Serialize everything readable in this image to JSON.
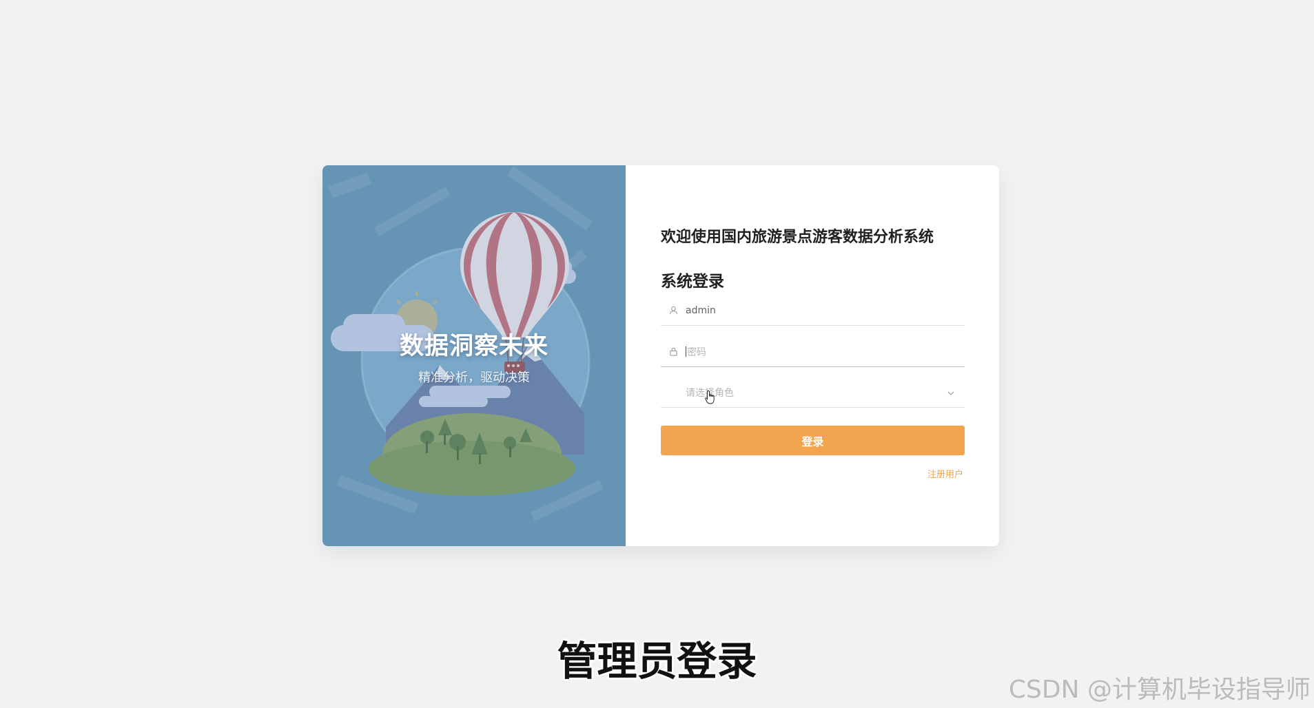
{
  "left_panel": {
    "headline": "数据洞察未来",
    "subheadline": "精准分析，驱动决策"
  },
  "form": {
    "welcome": "欢迎使用国内旅游景点游客数据分析系统",
    "title": "系统登录",
    "username": {
      "value": "admin",
      "icon": "user-icon"
    },
    "password": {
      "placeholder": "密码",
      "icon": "lock-icon"
    },
    "role": {
      "placeholder": "请选择角色",
      "icon": "chevron-down-icon"
    },
    "login_label": "登录",
    "register_label": "注册用户"
  },
  "colors": {
    "accent": "#f2a54e",
    "panel": "#6996b6",
    "background": "#f1f2f4"
  },
  "caption": "管理员登录",
  "watermark": "CSDN @计算机毕设指导师"
}
